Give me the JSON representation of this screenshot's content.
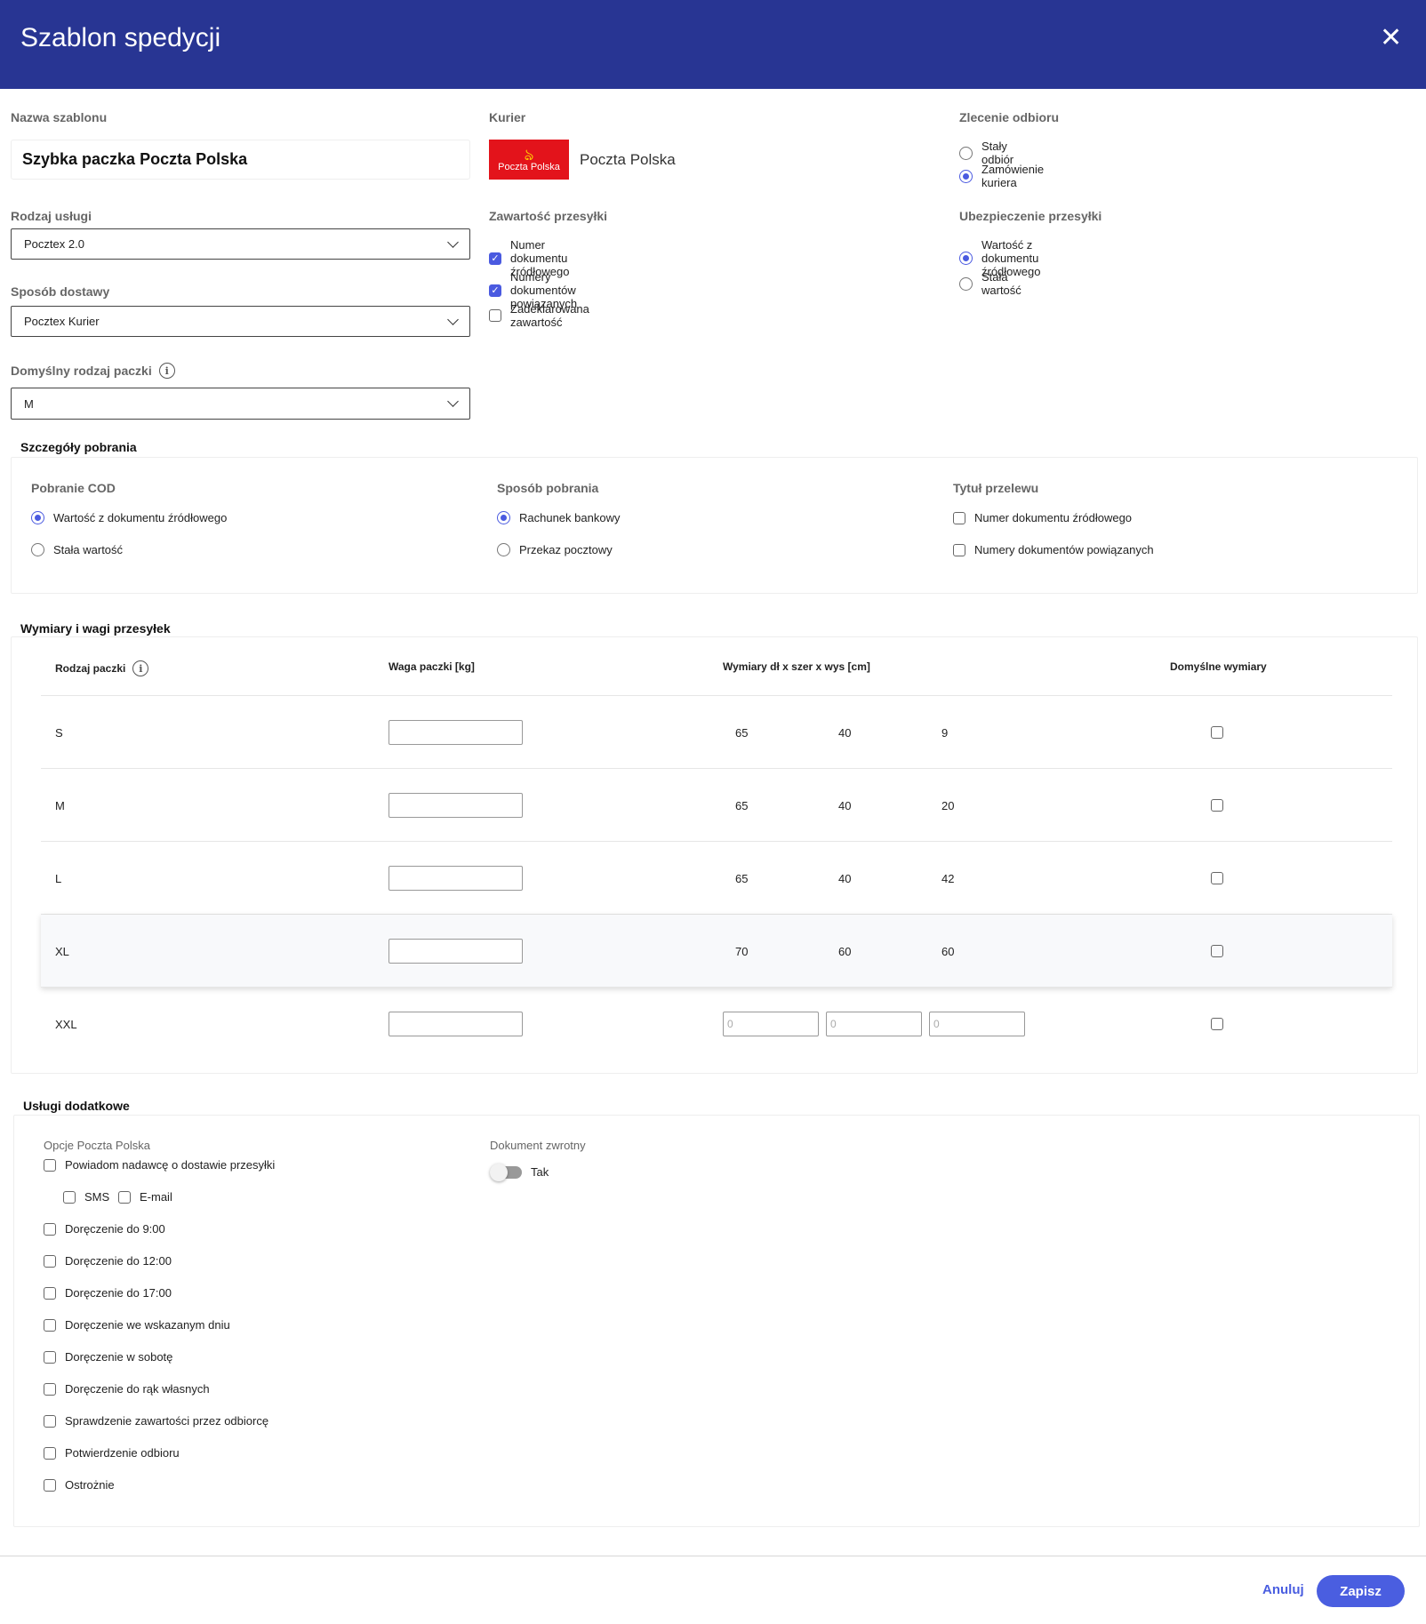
{
  "header": {
    "title": "Szablon spedycji",
    "close_icon": "close-icon"
  },
  "template_name": {
    "label": "Nazwa szablonu",
    "value": "Szybka paczka Poczta Polska"
  },
  "courier": {
    "label": "Kurier",
    "logo_text": "Poczta Polska",
    "name": "Poczta Polska"
  },
  "pickup": {
    "label": "Zlecenie odbioru",
    "options": [
      {
        "label": "Stały odbiór",
        "selected": false
      },
      {
        "label": "Zamówienie kuriera",
        "selected": true
      }
    ]
  },
  "service": {
    "label": "Rodzaj usługi",
    "value": "Pocztex 2.0"
  },
  "delivery": {
    "label": "Sposób dostawy",
    "value": "Pocztex Kurier"
  },
  "default_package": {
    "label": "Domyślny rodzaj paczki",
    "value": "M"
  },
  "contents": {
    "label": "Zawartość przesyłki",
    "options": [
      {
        "label": "Numer dokumentu źródłowego",
        "checked": true
      },
      {
        "label": "Numery dokumentów powiązanych",
        "checked": true
      },
      {
        "label": "Zadeklarowana zawartość",
        "checked": false
      }
    ]
  },
  "insurance": {
    "label": "Ubezpieczenie przesyłki",
    "options": [
      {
        "label": "Wartość z dokumentu źródłowego",
        "selected": true
      },
      {
        "label": "Stała wartość",
        "selected": false
      }
    ]
  },
  "cod": {
    "title": "Szczegóły pobrania",
    "columns": [
      {
        "label": "Pobranie COD",
        "type": "radio",
        "options": [
          {
            "label": "Wartość z dokumentu źródłowego",
            "on": true
          },
          {
            "label": "Stała wartość",
            "on": false
          }
        ]
      },
      {
        "label": "Sposób pobrania",
        "type": "radio",
        "options": [
          {
            "label": "Rachunek bankowy",
            "on": true
          },
          {
            "label": "Przekaz pocztowy",
            "on": false
          }
        ]
      },
      {
        "label": "Tytuł przelewu",
        "type": "check",
        "options": [
          {
            "label": "Numer dokumentu źródłowego",
            "on": false
          },
          {
            "label": "Numery dokumentów powiązanych",
            "on": false
          }
        ]
      }
    ]
  },
  "dimensions": {
    "title": "Wymiary i wagi przesyłek",
    "headers": {
      "type": "Rodzaj paczki",
      "weight": "Waga paczki [kg]",
      "dims": "Wymiary dł x szer x wys [cm]",
      "default": "Domyślne wymiary"
    },
    "rows": [
      {
        "type": "S",
        "l": "65",
        "w": "40",
        "h": "9",
        "editable": false
      },
      {
        "type": "M",
        "l": "65",
        "w": "40",
        "h": "20",
        "editable": false
      },
      {
        "type": "L",
        "l": "65",
        "w": "40",
        "h": "42",
        "editable": false
      },
      {
        "type": "XL",
        "l": "70",
        "w": "60",
        "h": "60",
        "editable": false
      },
      {
        "type": "XXL",
        "l": "0",
        "w": "0",
        "h": "0",
        "editable": true
      }
    ]
  },
  "extras": {
    "title": "Usługi dodatkowe",
    "options_label": "Opcje Poczta Polska",
    "notify": "Powiadom nadawcę o dostawie przesyłki",
    "sms": "SMS",
    "email": "E-mail",
    "options": [
      "Doręczenie do 9:00",
      "Doręczenie do 12:00",
      "Doręczenie do 17:00",
      "Doręczenie we wskazanym dniu",
      "Doręczenie w sobotę",
      "Doręczenie do rąk własnych",
      "Sprawdzenie zawartości przez odbiorcę",
      "Potwierdzenie odbioru",
      "Ostrożnie"
    ],
    "return_doc_label": "Dokument zwrotny",
    "return_doc_toggle": "Tak"
  },
  "footer": {
    "cancel": "Anuluj",
    "save": "Zapisz"
  },
  "colors": {
    "header": "#283593",
    "accent": "#4a5ae0",
    "logo": "#e3131b"
  }
}
